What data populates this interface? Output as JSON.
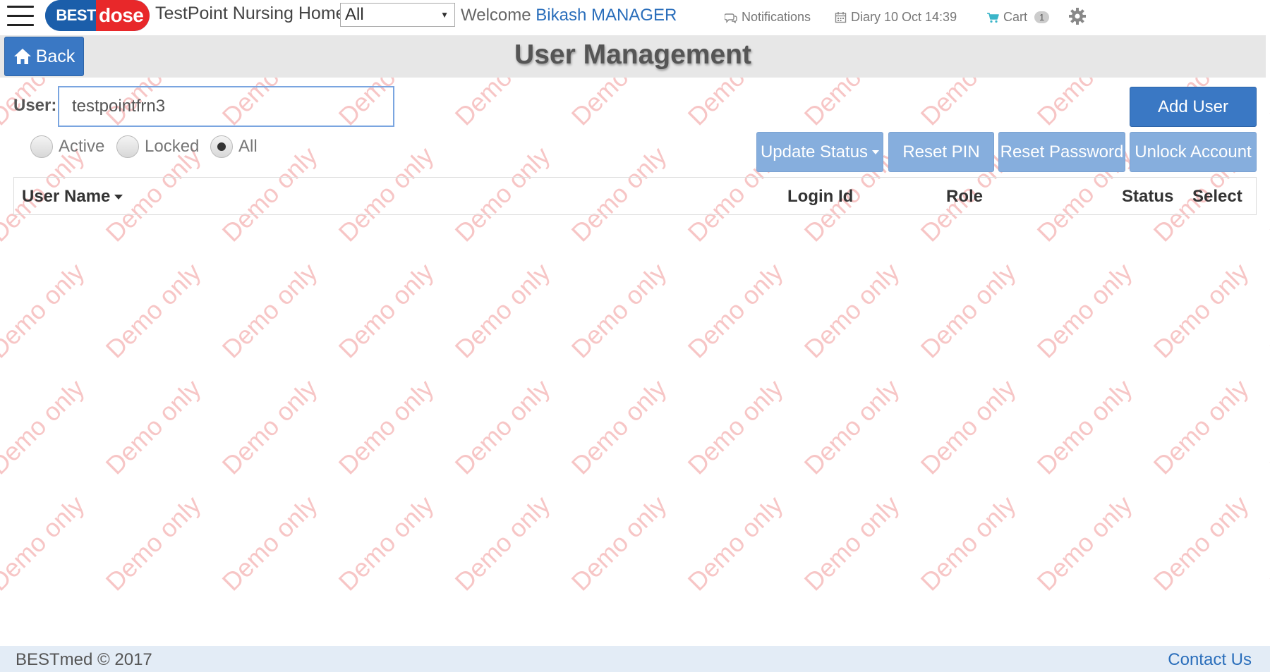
{
  "header": {
    "logo_part1": "BEST",
    "logo_part2": "dose",
    "facility_name": "TestPoint Nursing Home",
    "facility_filter": "All",
    "welcome_text": "Welcome",
    "user_name": "Bikash MANAGER",
    "notifications_label": "Notifications",
    "diary_label": "Diary 10 Oct 14:39",
    "cart_label": "Cart",
    "cart_count": "1"
  },
  "titlebar": {
    "back_label": "Back",
    "title": "User Management"
  },
  "filter": {
    "user_label": "User:",
    "user_value": "testpointfrn3",
    "radios": [
      {
        "label": "Active",
        "checked": false
      },
      {
        "label": "Locked",
        "checked": false
      },
      {
        "label": "All",
        "checked": true
      }
    ]
  },
  "actions": {
    "add_user": "Add User",
    "update_status": "Update Status",
    "reset_pin": "Reset PIN",
    "reset_password": "Reset Password",
    "unlock_account": "Unlock Account"
  },
  "table": {
    "columns": [
      "User Name",
      "Login Id",
      "Role",
      "Status",
      "Select"
    ]
  },
  "watermark": "Demo only",
  "footer": {
    "copyright": "BESTmed © 2017",
    "contact": "Contact Us"
  },
  "colors": {
    "primary": "#3a78c4",
    "primary_light": "#86aedd",
    "watermark": "#f7c6c6",
    "footer_bg": "#e3ecf6",
    "link": "#2a6ebb",
    "logo_blue": "#1b5eaa",
    "logo_red": "#e8282a"
  }
}
